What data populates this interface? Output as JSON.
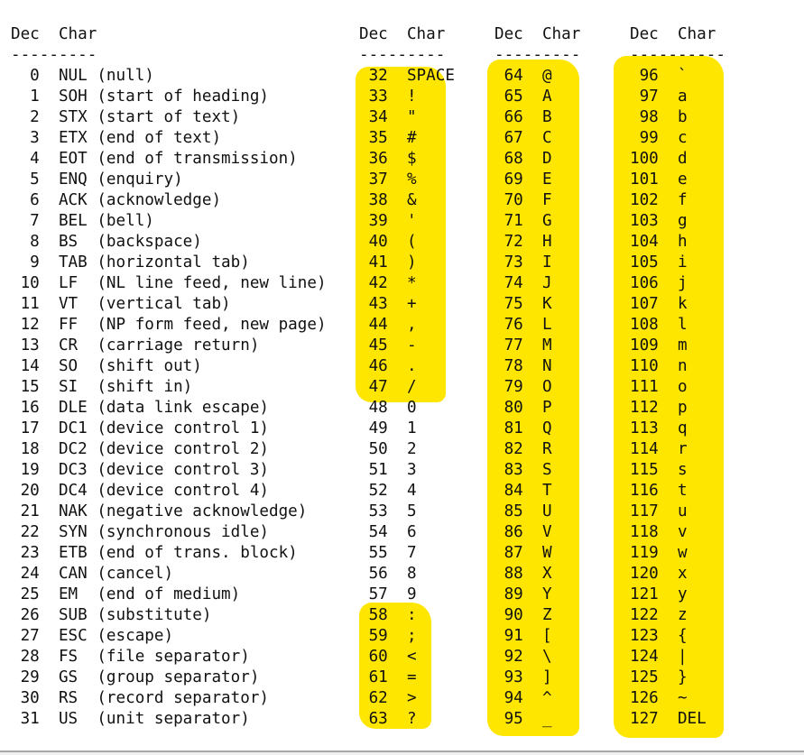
{
  "highlight_color": "#FFE600",
  "header": {
    "dec": "Dec",
    "char": "Char"
  },
  "columns": [
    {
      "rule": "---------",
      "rows": [
        [
          "0",
          "NUL (null)"
        ],
        [
          "1",
          "SOH (start of heading)"
        ],
        [
          "2",
          "STX (start of text)"
        ],
        [
          "3",
          "ETX (end of text)"
        ],
        [
          "4",
          "EOT (end of transmission)"
        ],
        [
          "5",
          "ENQ (enquiry)"
        ],
        [
          "6",
          "ACK (acknowledge)"
        ],
        [
          "7",
          "BEL (bell)"
        ],
        [
          "8",
          "BS  (backspace)"
        ],
        [
          "9",
          "TAB (horizontal tab)"
        ],
        [
          "10",
          "LF  (NL line feed, new line)"
        ],
        [
          "11",
          "VT  (vertical tab)"
        ],
        [
          "12",
          "FF  (NP form feed, new page)"
        ],
        [
          "13",
          "CR  (carriage return)"
        ],
        [
          "14",
          "SO  (shift out)"
        ],
        [
          "15",
          "SI  (shift in)"
        ],
        [
          "16",
          "DLE (data link escape)"
        ],
        [
          "17",
          "DC1 (device control 1)"
        ],
        [
          "18",
          "DC2 (device control 2)"
        ],
        [
          "19",
          "DC3 (device control 3)"
        ],
        [
          "20",
          "DC4 (device control 4)"
        ],
        [
          "21",
          "NAK (negative acknowledge)"
        ],
        [
          "22",
          "SYN (synchronous idle)"
        ],
        [
          "23",
          "ETB (end of trans. block)"
        ],
        [
          "24",
          "CAN (cancel)"
        ],
        [
          "25",
          "EM  (end of medium)"
        ],
        [
          "26",
          "SUB (substitute)"
        ],
        [
          "27",
          "ESC (escape)"
        ],
        [
          "28",
          "FS  (file separator)"
        ],
        [
          "29",
          "GS  (group separator)"
        ],
        [
          "30",
          "RS  (record separator)"
        ],
        [
          "31",
          "US  (unit separator)"
        ]
      ]
    },
    {
      "rule": "---------",
      "rows": [
        [
          "32",
          "SPACE"
        ],
        [
          "33",
          "!"
        ],
        [
          "34",
          "\""
        ],
        [
          "35",
          "#"
        ],
        [
          "36",
          "$"
        ],
        [
          "37",
          "%"
        ],
        [
          "38",
          "&"
        ],
        [
          "39",
          "'"
        ],
        [
          "40",
          "("
        ],
        [
          "41",
          ")"
        ],
        [
          "42",
          "*"
        ],
        [
          "43",
          "+"
        ],
        [
          "44",
          ","
        ],
        [
          "45",
          "-"
        ],
        [
          "46",
          "."
        ],
        [
          "47",
          "/"
        ],
        [
          "48",
          "0"
        ],
        [
          "49",
          "1"
        ],
        [
          "50",
          "2"
        ],
        [
          "51",
          "3"
        ],
        [
          "52",
          "4"
        ],
        [
          "53",
          "5"
        ],
        [
          "54",
          "6"
        ],
        [
          "55",
          "7"
        ],
        [
          "56",
          "8"
        ],
        [
          "57",
          "9"
        ],
        [
          "58",
          ":"
        ],
        [
          "59",
          ";"
        ],
        [
          "60",
          "<"
        ],
        [
          "61",
          "="
        ],
        [
          "62",
          ">"
        ],
        [
          "63",
          "?"
        ]
      ]
    },
    {
      "rule": "---------",
      "rows": [
        [
          "64",
          "@"
        ],
        [
          "65",
          "A"
        ],
        [
          "66",
          "B"
        ],
        [
          "67",
          "C"
        ],
        [
          "68",
          "D"
        ],
        [
          "69",
          "E"
        ],
        [
          "70",
          "F"
        ],
        [
          "71",
          "G"
        ],
        [
          "72",
          "H"
        ],
        [
          "73",
          "I"
        ],
        [
          "74",
          "J"
        ],
        [
          "75",
          "K"
        ],
        [
          "76",
          "L"
        ],
        [
          "77",
          "M"
        ],
        [
          "78",
          "N"
        ],
        [
          "79",
          "O"
        ],
        [
          "80",
          "P"
        ],
        [
          "81",
          "Q"
        ],
        [
          "82",
          "R"
        ],
        [
          "83",
          "S"
        ],
        [
          "84",
          "T"
        ],
        [
          "85",
          "U"
        ],
        [
          "86",
          "V"
        ],
        [
          "87",
          "W"
        ],
        [
          "88",
          "X"
        ],
        [
          "89",
          "Y"
        ],
        [
          "90",
          "Z"
        ],
        [
          "91",
          "["
        ],
        [
          "92",
          "\\"
        ],
        [
          "93",
          "]"
        ],
        [
          "94",
          "^"
        ],
        [
          "95",
          "_"
        ]
      ]
    },
    {
      "rule": "----------",
      "rows": [
        [
          "96",
          "`"
        ],
        [
          "97",
          "a"
        ],
        [
          "98",
          "b"
        ],
        [
          "99",
          "c"
        ],
        [
          "100",
          "d"
        ],
        [
          "101",
          "e"
        ],
        [
          "102",
          "f"
        ],
        [
          "103",
          "g"
        ],
        [
          "104",
          "h"
        ],
        [
          "105",
          "i"
        ],
        [
          "106",
          "j"
        ],
        [
          "107",
          "k"
        ],
        [
          "108",
          "l"
        ],
        [
          "109",
          "m"
        ],
        [
          "110",
          "n"
        ],
        [
          "111",
          "o"
        ],
        [
          "112",
          "p"
        ],
        [
          "113",
          "q"
        ],
        [
          "114",
          "r"
        ],
        [
          "115",
          "s"
        ],
        [
          "116",
          "t"
        ],
        [
          "117",
          "u"
        ],
        [
          "118",
          "v"
        ],
        [
          "119",
          "w"
        ],
        [
          "120",
          "x"
        ],
        [
          "121",
          "y"
        ],
        [
          "122",
          "z"
        ],
        [
          "123",
          "{"
        ],
        [
          "124",
          "|"
        ],
        [
          "125",
          "}"
        ],
        [
          "126",
          "~"
        ],
        [
          "127",
          "DEL"
        ]
      ]
    }
  ]
}
